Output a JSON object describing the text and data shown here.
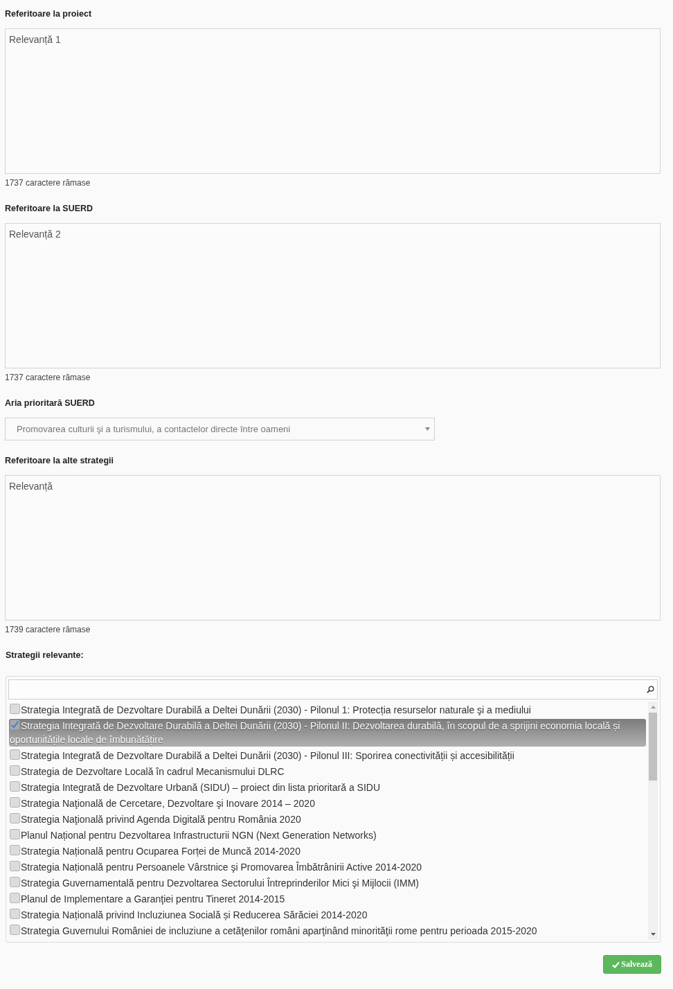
{
  "sections": [
    {
      "kind": "textarea",
      "label": "Referitoare la proiect",
      "value": "Relevanță 1",
      "counter": "1737 caractere rămase"
    },
    {
      "kind": "textarea",
      "label": "Referitoare la SUERD",
      "value": "Relevanță 2",
      "counter": "1737 caractere rămase"
    },
    {
      "kind": "select",
      "label": "Aria prioritară SUERD",
      "value": "Promovarea culturii şi a turismului, a contactelor directe între oameni"
    },
    {
      "kind": "textarea",
      "label": "Referitoare la alte strategii",
      "value": "Relevanță",
      "counter": "1739 caractere rămase"
    },
    {
      "kind": "checklist",
      "label": "Strategii relevante:",
      "items": [
        {
          "label": "Strategia Integrată de Dezvoltare Durabilă a Deltei Dunării (2030) - Pilonul 1: Protecția resurselor naturale şi a mediului",
          "checked": false,
          "selected": false
        },
        {
          "label": "Strategia Integrată de Dezvoltare Durabilă a Deltei Dunării (2030) - Pilonul II: Dezvoltarea durabilă, în scopul de a sprijini economia locală și oportunitățile locale de îmbunătățire",
          "checked": true,
          "selected": true
        },
        {
          "label": "Strategia Integrată de Dezvoltare Durabilă a Deltei Dunării (2030) - Pilonul III: Sporirea conectivității și accesibilității",
          "checked": false,
          "selected": false
        },
        {
          "label": "Strategia de Dezvoltare Locală în cadrul Mecanismului DLRC",
          "checked": false,
          "selected": false
        },
        {
          "label": "Strategia Integrată de Dezvoltare Urbană (SIDU) – proiect din lista prioritară a SIDU",
          "checked": false,
          "selected": false
        },
        {
          "label": "Strategia Naţională de Cercetare, Dezvoltare şi Inovare 2014 – 2020",
          "checked": false,
          "selected": false
        },
        {
          "label": "Strategia Naţională privind Agenda Digitală pentru România 2020",
          "checked": false,
          "selected": false
        },
        {
          "label": "Planul Național pentru Dezvoltarea Infrastructurii NGN (Next Generation Networks)",
          "checked": false,
          "selected": false
        },
        {
          "label": "Strategia Națională pentru Ocuparea Forței de Muncă 2014-2020",
          "checked": false,
          "selected": false
        },
        {
          "label": "Strategia Națională pentru Persoanele Vârstnice şi Promovarea Îmbătrânirii Active 2014-2020",
          "checked": false,
          "selected": false
        },
        {
          "label": "Strategia Guvernamentală pentru Dezvoltarea Sectorului Întreprinderilor Mici şi Mijlocii (IMM)",
          "checked": false,
          "selected": false
        },
        {
          "label": "Planul de Implementare a Garanţiei pentru Tineret 2014-2015",
          "checked": false,
          "selected": false
        },
        {
          "label": "Strategia Națională privind Incluziunea Socială și Reducerea Sărăciei 2014-2020",
          "checked": false,
          "selected": false
        },
        {
          "label": "Strategia Guvernului României de incluziune a cetăţenilor români aparţinând minorităţii rome pentru perioada 2015-2020",
          "checked": false,
          "selected": false
        }
      ]
    }
  ],
  "save_button": {
    "label": "Salvează"
  }
}
